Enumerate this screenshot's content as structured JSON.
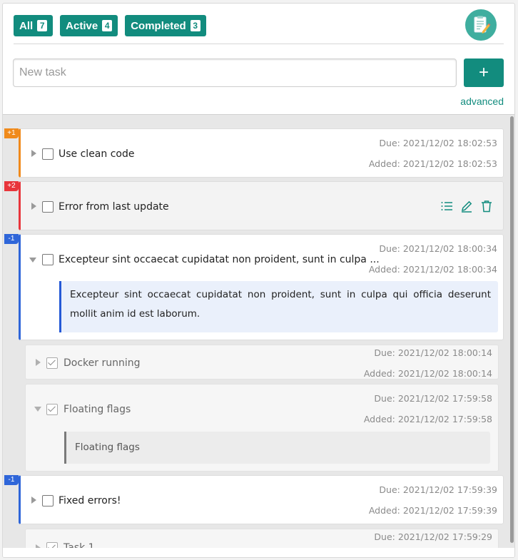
{
  "filters": [
    {
      "label": "All",
      "count": "7"
    },
    {
      "label": "Active",
      "count": "4"
    },
    {
      "label": "Completed",
      "count": "3"
    }
  ],
  "logo_icon": "notepad-pencil-icon",
  "new_task": {
    "placeholder": "New task",
    "value": ""
  },
  "add_button": {
    "label": "+"
  },
  "advanced_link": "advanced",
  "colors": {
    "accent": "#128c7e",
    "priority_plus1": "#f08a1b",
    "priority_plus2": "#e8353b",
    "priority_minus1": "#2f66d9",
    "description_bg": "#eaf0fb"
  },
  "tasks": [
    {
      "priority": "+1",
      "title": "Use clean code",
      "due": "Due: 2021/12/02 18:02:53",
      "added": "Added: 2021/12/02 18:02:53",
      "expanded": false,
      "completed": false
    },
    {
      "priority": "+2",
      "title": "Error from last update",
      "hover_actions": [
        "list-icon",
        "edit-icon",
        "trash-icon"
      ],
      "expanded": false,
      "completed": false
    },
    {
      "priority": "-1",
      "title": "Excepteur sint occaecat cupidatat non proident, sunt in culpa ...",
      "due": "Due: 2021/12/02 18:00:34",
      "added": "Added: 2021/12/02 18:00:34",
      "expanded": true,
      "completed": false,
      "description": "Excepteur sint occaecat cupidatat non proident, sunt in culpa qui officia deserunt mollit anim id est laborum."
    },
    {
      "priority": "",
      "title": "Docker running",
      "due": "Due: 2021/12/02 18:00:14",
      "added": "Added: 2021/12/02 18:00:14",
      "expanded": false,
      "completed": true
    },
    {
      "priority": "",
      "title": "Floating flags",
      "due": "Due: 2021/12/02 17:59:58",
      "added": "Added: 2021/12/02 17:59:58",
      "expanded": true,
      "completed": true,
      "description": "Floating flags"
    },
    {
      "priority": "-1",
      "title": "Fixed errors!",
      "due": "Due: 2021/12/02 17:59:39",
      "added": "Added: 2021/12/02 17:59:39",
      "expanded": false,
      "completed": false
    },
    {
      "priority": "",
      "title": "Task 1",
      "due": "Due: 2021/12/02 17:59:29",
      "expanded": false,
      "completed": true
    }
  ]
}
